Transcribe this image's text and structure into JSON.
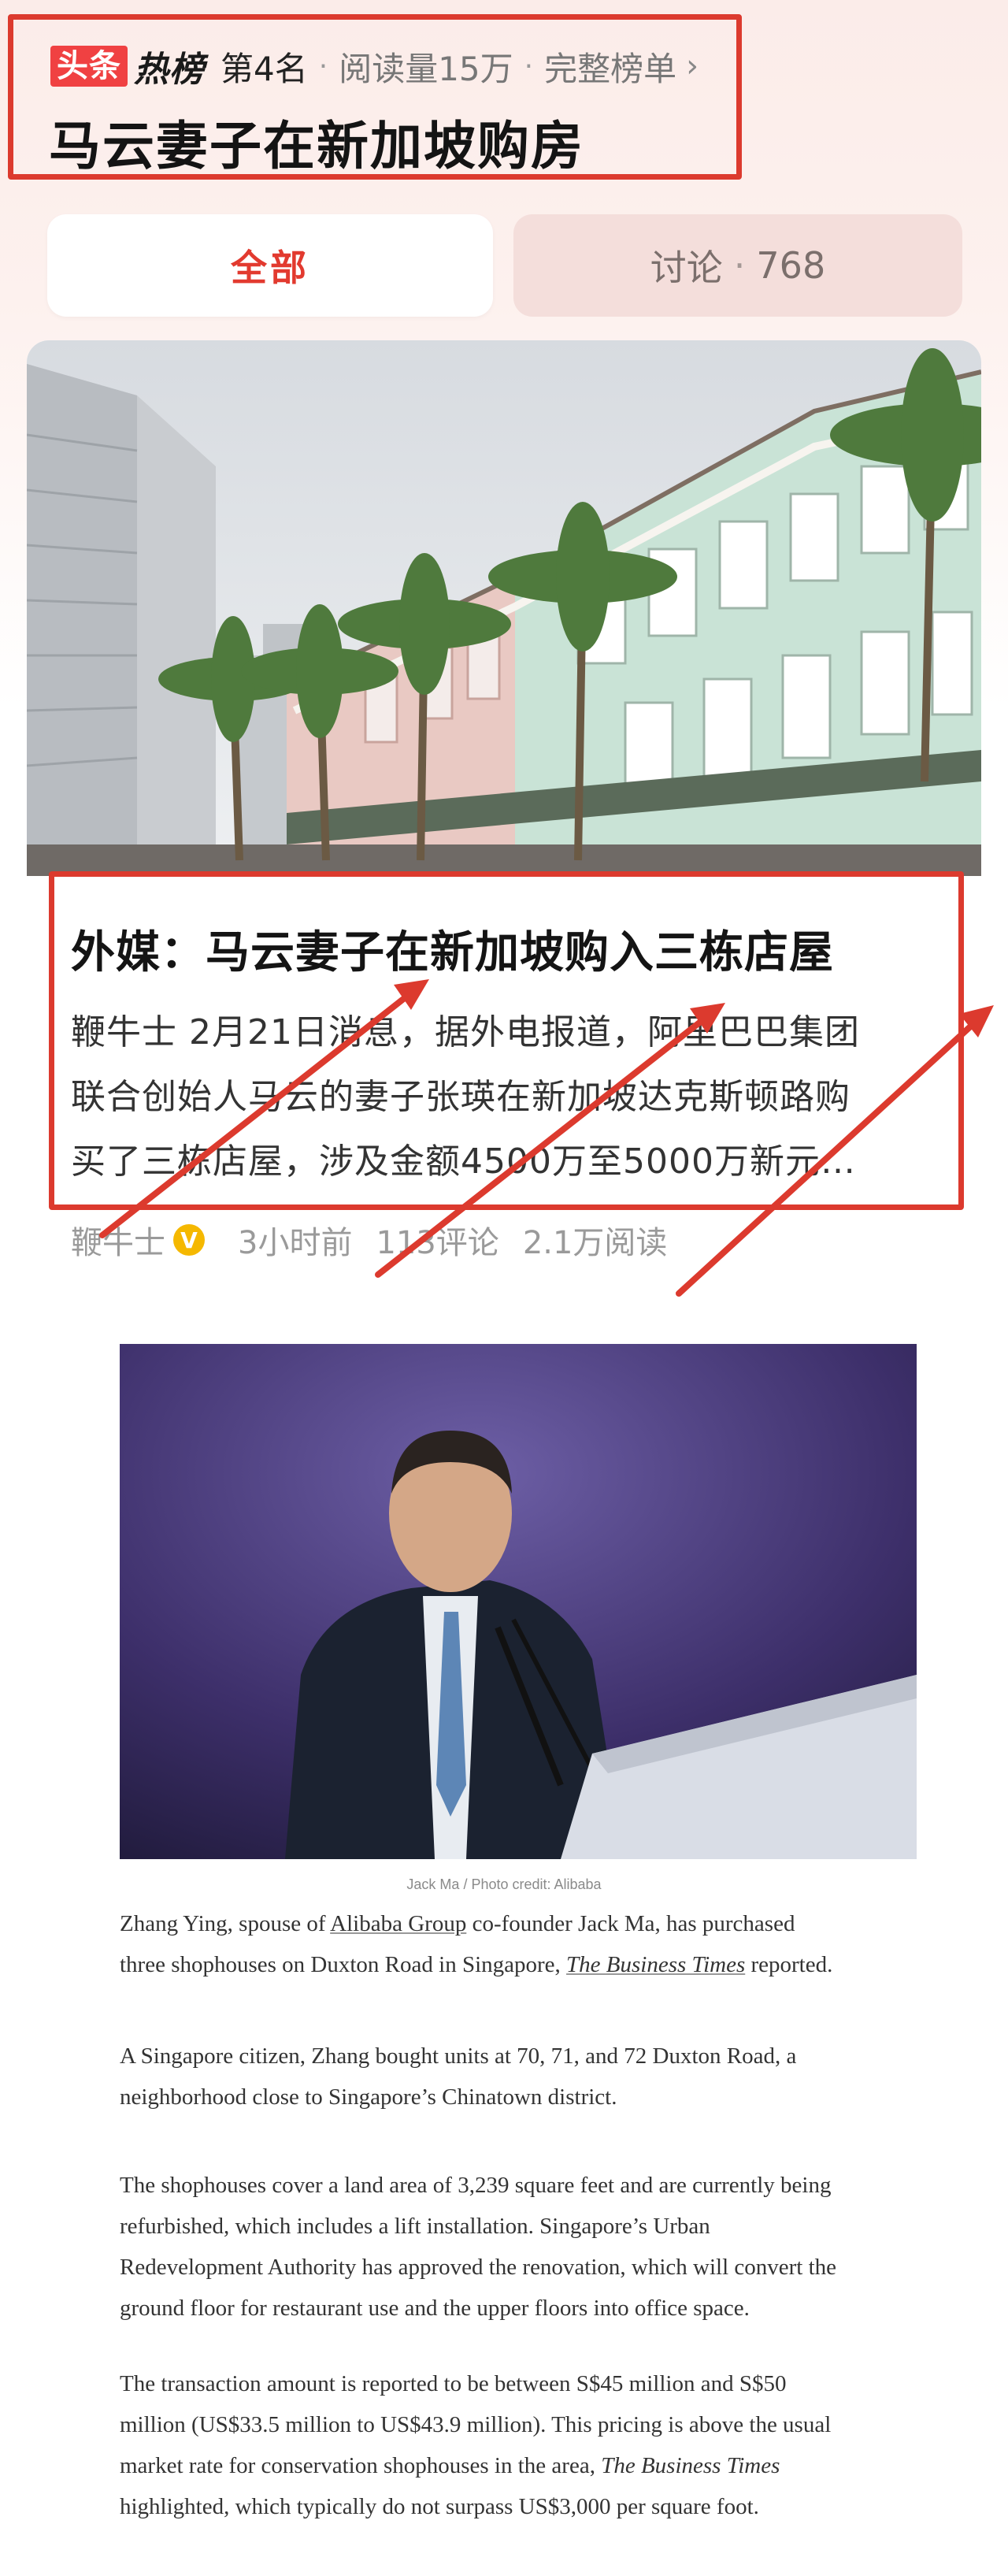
{
  "hot_list": {
    "brand_logo": "头条",
    "brand_hot": "热榜",
    "rank": "第4名",
    "sep": "·",
    "reads": "阅读量15万",
    "full_list_link": "完整榜单",
    "chevron": "›",
    "topic_title": "马云妻子在新加坡购房"
  },
  "tabs": {
    "all": "全部",
    "discuss_label": "讨论",
    "sep": "·",
    "discuss_count": "768"
  },
  "news_card": {
    "title": "外媒：马云妻子在新加坡购入三栋店屋",
    "summary_lines": [
      "鞭牛士 2月21日消息，据外电报道，阿里巴巴集团",
      "联合创始人马云的妻子张瑛在新加坡达克斯顿路购",
      "买了三栋店屋，涉及金额4500万至5000万新元…"
    ],
    "author": "鞭牛士",
    "verified_badge": "V",
    "time": "3小时前",
    "comments": "113评论",
    "reads": "2.1万阅读"
  },
  "en_article": {
    "caption": "Jack Ma / Photo credit: Alibaba",
    "p1": {
      "a": "Zhang Ying, spouse of ",
      "link": "Alibaba Group",
      "b": " co-founder Jack Ma, has purchased",
      "c": "three shophouses on Duxton Road in Singapore, ",
      "publication": "The Business Times",
      "d": " reported."
    },
    "p2_lines": [
      "A Singapore citizen, Zhang bought units at 70, 71, and 72 Duxton Road, a",
      "neighborhood close to Singapore’s Chinatown district."
    ],
    "p3_lines": [
      "The shophouses cover a land area of 3,239 square feet and are currently being",
      "refurbished, which includes a lift installation. Singapore’s Urban",
      "Redevelopment Authority has approved the renovation, which will convert the",
      "ground floor for restaurant use and the upper floors into office space."
    ],
    "p4": {
      "l1": "The transaction amount is reported to be between S$45 million and S$50",
      "l2": "million (US$33.5 million to US$43.9 million). This pricing is above the usual",
      "l3a": "market rate for conservation shophouses in the area, ",
      "publication": "The Business Times",
      "l4": "highlighted, which typically do not surpass US$3,000 per square foot."
    }
  },
  "colors": {
    "accent_red": "#dc3a2e",
    "brand_red": "#f04142",
    "verified_yellow": "#f5b800"
  }
}
